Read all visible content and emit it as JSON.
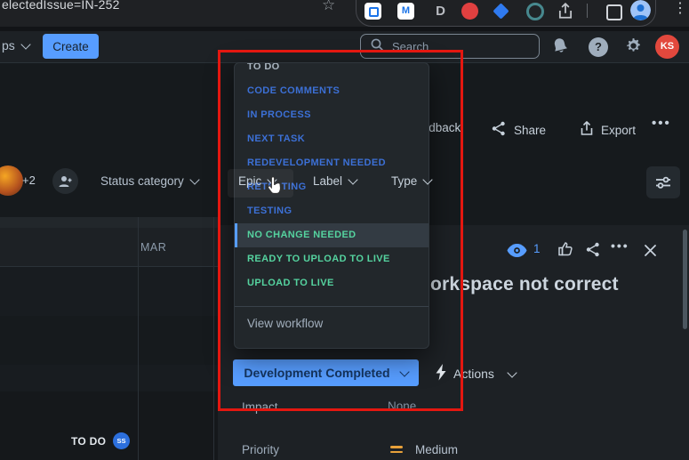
{
  "browser": {
    "url_text": "electedIssue=IN-252",
    "menu_dots": "⋮",
    "ext_m_label": "M",
    "ext_d_label": "D"
  },
  "navbar": {
    "apps_label": "ps",
    "create_label": "Create",
    "search_placeholder": "Search",
    "avatar_initials": "KS"
  },
  "filters": {
    "overflow_count": "+2",
    "status_category": "Status category",
    "epic": "Epic",
    "label": "Label",
    "type": "Type"
  },
  "toolbar": {
    "give_feedback": "Give feedback",
    "share": "Share",
    "export": "Export",
    "more": "•••"
  },
  "timeline": {
    "month": "MAR",
    "todo_label": "TO DO",
    "todo_avatar_initials": "SS"
  },
  "dropdown": {
    "items": [
      {
        "label": "TO DO",
        "category": "todo",
        "active": false
      },
      {
        "label": "CODE COMMENTS",
        "category": "inprogress",
        "active": false
      },
      {
        "label": "IN PROCESS",
        "category": "inprogress",
        "active": false
      },
      {
        "label": "NEXT TASK",
        "category": "inprogress",
        "active": false
      },
      {
        "label": "REDEVELOPMENT NEEDED",
        "category": "inprogress",
        "active": false
      },
      {
        "label": "RETESTING",
        "category": "inprogress",
        "active": false
      },
      {
        "label": "TESTING",
        "category": "inprogress",
        "active": false
      },
      {
        "label": "NO CHANGE NEEDED",
        "category": "done",
        "active": true
      },
      {
        "label": "READY TO UPLOAD TO LIVE",
        "category": "done",
        "active": false
      },
      {
        "label": "UPLOAD TO LIVE",
        "category": "done",
        "active": false
      }
    ],
    "footer": "View workflow"
  },
  "panel": {
    "watch_count": "1",
    "more": "•••",
    "title_fragment": "orkspace not correct",
    "status_button_label": "Development Completed",
    "actions_label": "Actions",
    "impact_label": "Impact",
    "impact_value": "None",
    "priority_label": "Priority",
    "priority_value": "Medium"
  },
  "colors": {
    "accent_blue": "#579dff",
    "status_todo_gray": "#a9b4bf",
    "status_inprogress_blue": "#3c70d6",
    "status_done_green": "#55d39f",
    "annotation_red": "#e41710",
    "priority_orange": "#e8a13a",
    "avatar_red": "#e2483d",
    "ss_badge_blue": "#2c6fdd"
  }
}
